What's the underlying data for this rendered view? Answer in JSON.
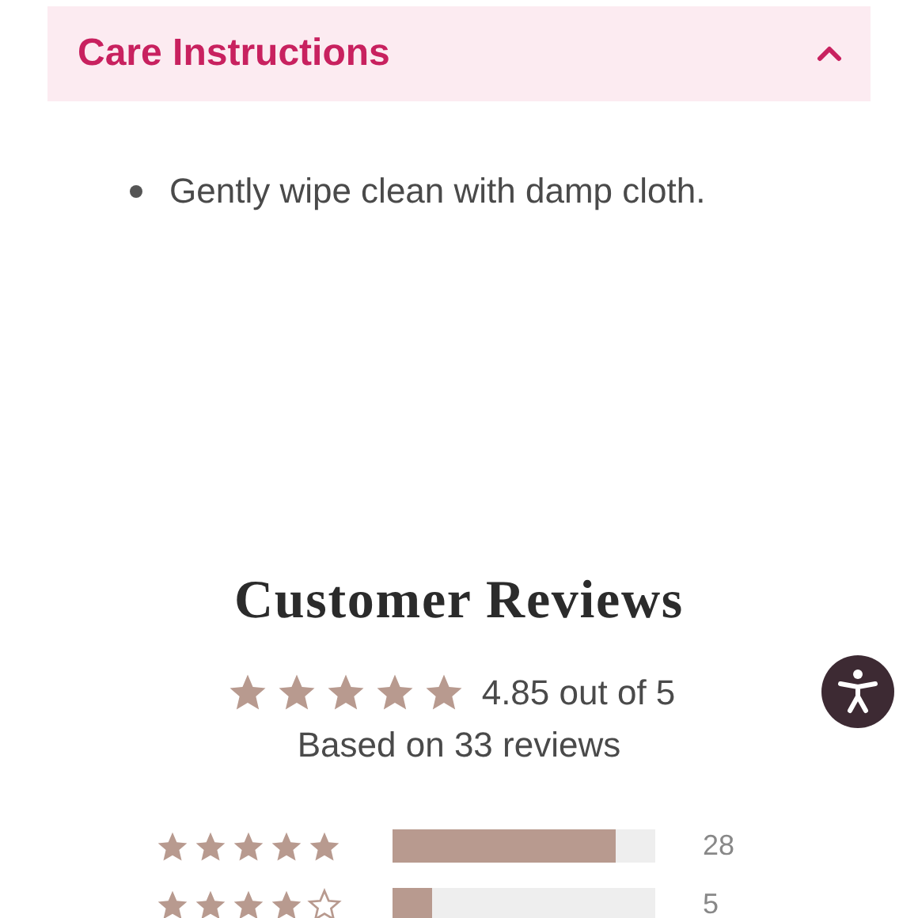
{
  "care_section": {
    "title": "Care Instructions",
    "expanded": true,
    "items": [
      "Gently wipe clean with damp cloth."
    ]
  },
  "reviews": {
    "title": "Customer Reviews",
    "stars": 5,
    "average": "4.85 out of 5",
    "count_text": "Based on 33 reviews",
    "histogram": [
      {
        "stars": 5,
        "level": 0.85,
        "count": "28"
      },
      {
        "stars": 4,
        "level": 0.15,
        "count": "5"
      }
    ]
  }
}
